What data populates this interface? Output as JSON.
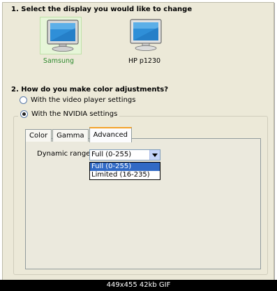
{
  "section1": {
    "heading": "1. Select the display you would like to change"
  },
  "displays": [
    {
      "label": "Samsung",
      "selected": true,
      "label_color": "#2d8a2d"
    },
    {
      "label": "HP p1230",
      "selected": false,
      "label_color": "#000000"
    }
  ],
  "section2": {
    "heading": "2. How do you make color adjustments?"
  },
  "radios": [
    {
      "label": "With the video player settings",
      "checked": false
    },
    {
      "label": "With the NVIDIA settings",
      "checked": true
    }
  ],
  "tabs": [
    {
      "label": "Color",
      "active": false
    },
    {
      "label": "Gamma",
      "active": false
    },
    {
      "label": "Advanced",
      "active": true
    }
  ],
  "advanced": {
    "dynamic_range_label": "Dynamic range:",
    "dynamic_range_value": "Full (0-255)",
    "options": [
      {
        "label": "Full (0-255)",
        "selected": true
      },
      {
        "label": "Limited (16-235)",
        "selected": false
      }
    ]
  },
  "caption": "449x455 42kb GIF",
  "colors": {
    "window_bg": "#ece9d8",
    "selection": "#316ac5",
    "tab_accent": "#f4a22a",
    "selected_tile": "#e6f5d8"
  }
}
